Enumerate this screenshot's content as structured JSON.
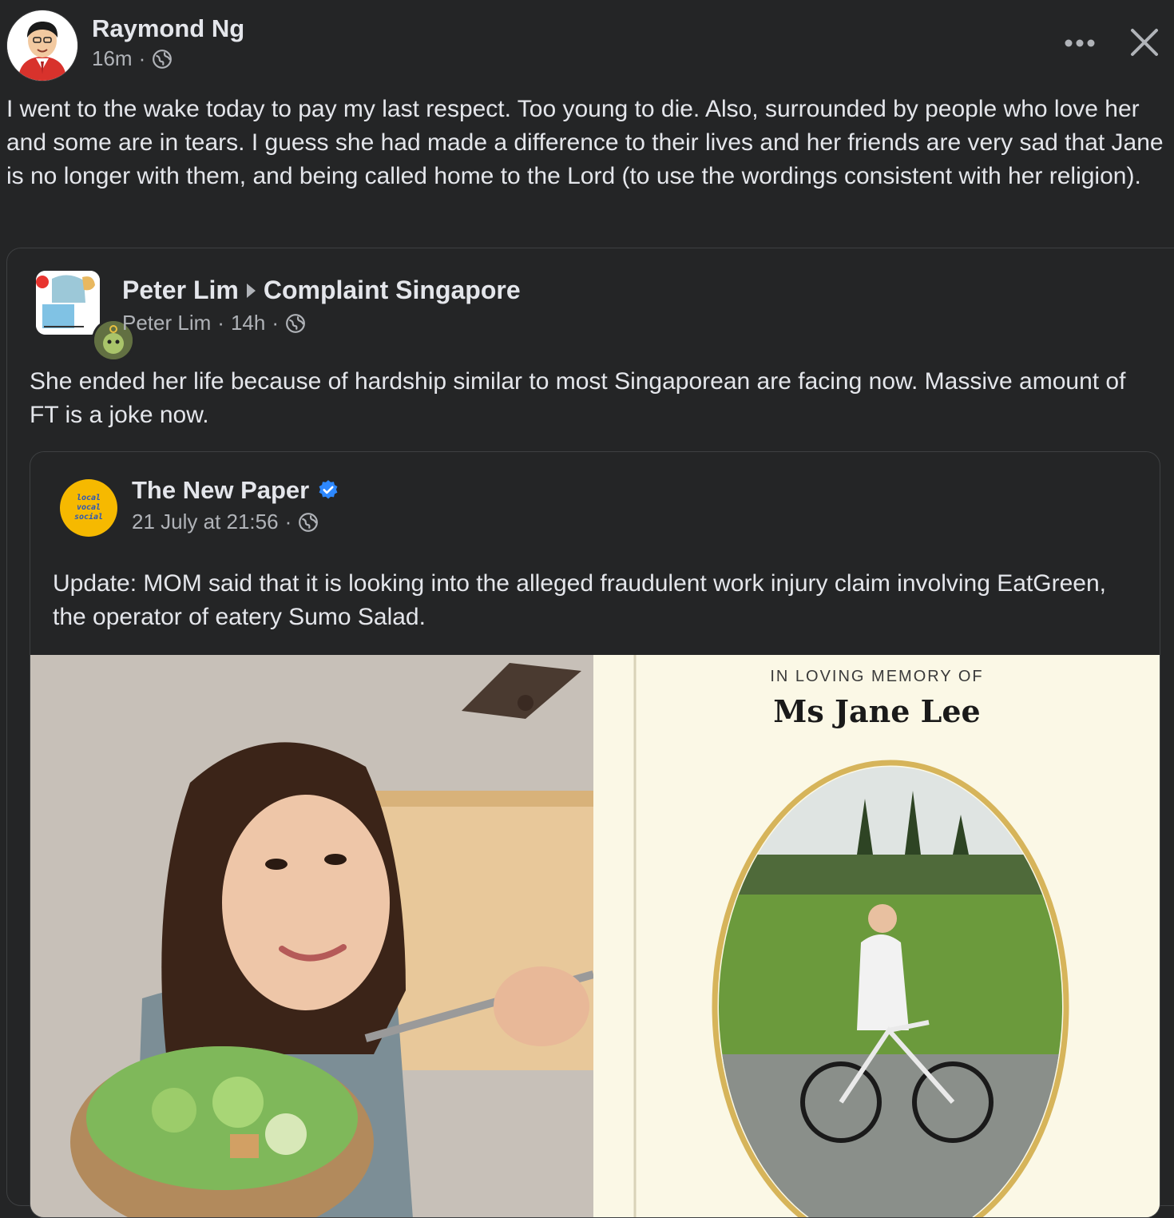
{
  "post": {
    "author": "Raymond Ng",
    "time": "16m",
    "separator": "·",
    "text": "I went to the wake today to pay my last respect. Too young to die. Also, surrounded by people who love her and some are in tears. I guess she had made a difference to their lives and her friends are very sad that Jane is no longer with them, and being called home to the Lord (to use the wordings consistent with her religion)."
  },
  "shared_post": {
    "author": "Peter Lim",
    "group": "Complaint Singapore",
    "sub_author": "Peter Lim",
    "time": "14h",
    "separator": "·",
    "text": "She ended her life because of hardship similar to most Singaporean are facing now. Massive amount of FT is a joke now."
  },
  "inner_post": {
    "author": "The New Paper",
    "avatar_text": [
      "local",
      "vocal",
      "social"
    ],
    "time": "21 July at 21:56",
    "separator": "·",
    "text": "Update: MOM said that it is looking into the alleged fraudulent work injury claim involving EatGreen, the operator of eatery Sumo Salad.",
    "memorial_caption": "IN LOVING MEMORY OF",
    "memorial_name": "Ms Jane Lee"
  },
  "colors": {
    "background": "#242526",
    "text_primary": "#e4e6eb",
    "text_secondary": "#b0b3b8",
    "verified": "#2d88ff",
    "tnp_avatar": "#f6b900"
  },
  "icons": [
    "globe-icon",
    "more-icon",
    "close-icon",
    "verified-icon",
    "arrow-right-icon"
  ]
}
